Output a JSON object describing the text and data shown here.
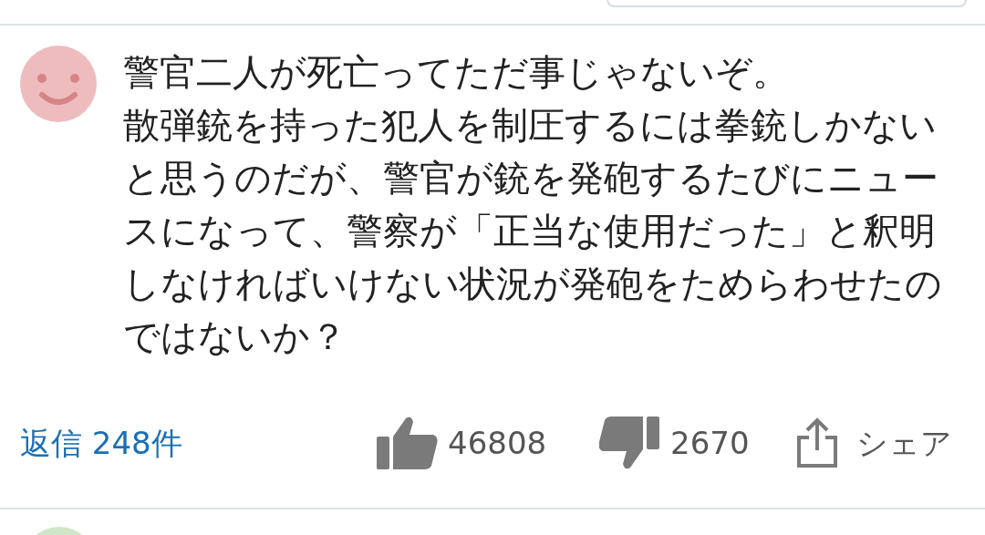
{
  "comment": {
    "paragraphs": [
      "警官二人が死亡ってただ事じゃないぞ。",
      "散弾銃を持った犯人を制圧するには拳銃しかないと思うのだが、警官が銃を発砲するたびにニュースになって、警察が「正当な使用だった」と釈明しなければいけない状況が発砲をためらわせたのではないか？"
    ],
    "replies": "返信 248件",
    "likes": "46808",
    "dislikes": "2670",
    "share": "シェア"
  }
}
